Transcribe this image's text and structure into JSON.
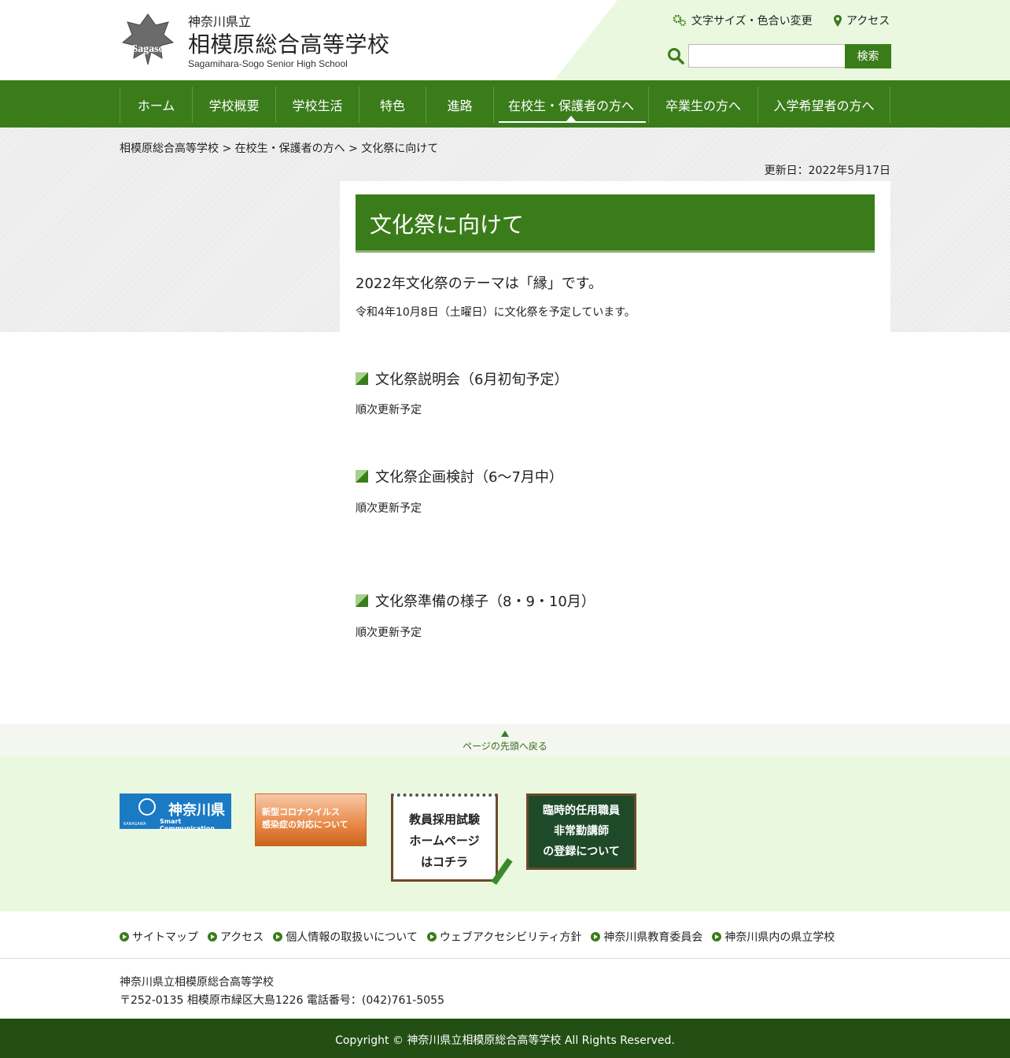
{
  "header": {
    "pref": "神奈川県立",
    "school_name": "相模原総合高等学校",
    "school_name_en": "Sagamihara-Sogo Senior High School",
    "logo_text": "Sagaso",
    "util_fontsize": "文字サイズ・色合い変更",
    "util_access": "アクセス",
    "search_placeholder": "",
    "search_button": "検索"
  },
  "nav": {
    "items": [
      {
        "label": "ホーム"
      },
      {
        "label": "学校概要"
      },
      {
        "label": "学校生活"
      },
      {
        "label": "特色"
      },
      {
        "label": "進路"
      },
      {
        "label": "在校生・保護者の方へ"
      },
      {
        "label": "卒業生の方へ"
      },
      {
        "label": "入学希望者の方へ"
      }
    ],
    "active_index": 5
  },
  "breadcrumb": "相模原総合高等学校 > 在校生・保護者の方へ > 文化祭に向けて",
  "updated": "更新日：2022年5月17日",
  "page": {
    "title": "文化祭に向けて",
    "lead": "2022年文化祭のテーマは「縁」です。",
    "sub": "令和4年10月8日（土曜日）に文化祭を予定しています。",
    "sections": [
      {
        "heading": "文化祭説明会（6月初旬予定）",
        "text": "順次更新予定"
      },
      {
        "heading": "文化祭企画検討（6～7月中）",
        "text": "順次更新予定"
      },
      {
        "heading": "文化祭準備の様子（8・9・10月）",
        "text": "順次更新予定"
      }
    ]
  },
  "pagetop": "ページの先頭へ戻る",
  "banners": {
    "kanagawa": {
      "title": "神奈川県",
      "subtitle": "Smart Communication",
      "small": "KANAGAWA"
    },
    "covid": {
      "line1": "新型コロナウイルス",
      "line2": "感染症の対応について"
    },
    "teacher": {
      "line1": "教員採用試験",
      "line2": "ホームページ",
      "line3": "はコチラ"
    },
    "board": {
      "line1": "臨時的任用職員",
      "line2": "非常勤講師",
      "line3": "の登録について"
    }
  },
  "footer": {
    "links": [
      {
        "label": "サイトマップ"
      },
      {
        "label": "アクセス"
      },
      {
        "label": "個人情報の取扱いについて"
      },
      {
        "label": "ウェブアクセシビリティ方針"
      },
      {
        "label": "神奈川県教育委員会"
      },
      {
        "label": "神奈川県内の県立学校"
      }
    ],
    "address_name": "神奈川県立相模原総合高等学校",
    "address_detail": "〒252-0135 相模原市緑区大島1226 電話番号：(042)761-5055",
    "copyright": "Copyright © 神奈川県立相模原総合高等学校 All Rights Reserved."
  },
  "colors": {
    "brand_green": "#3a7c1a",
    "light_green": "#eaf8df",
    "footer_dark": "#234f14"
  }
}
